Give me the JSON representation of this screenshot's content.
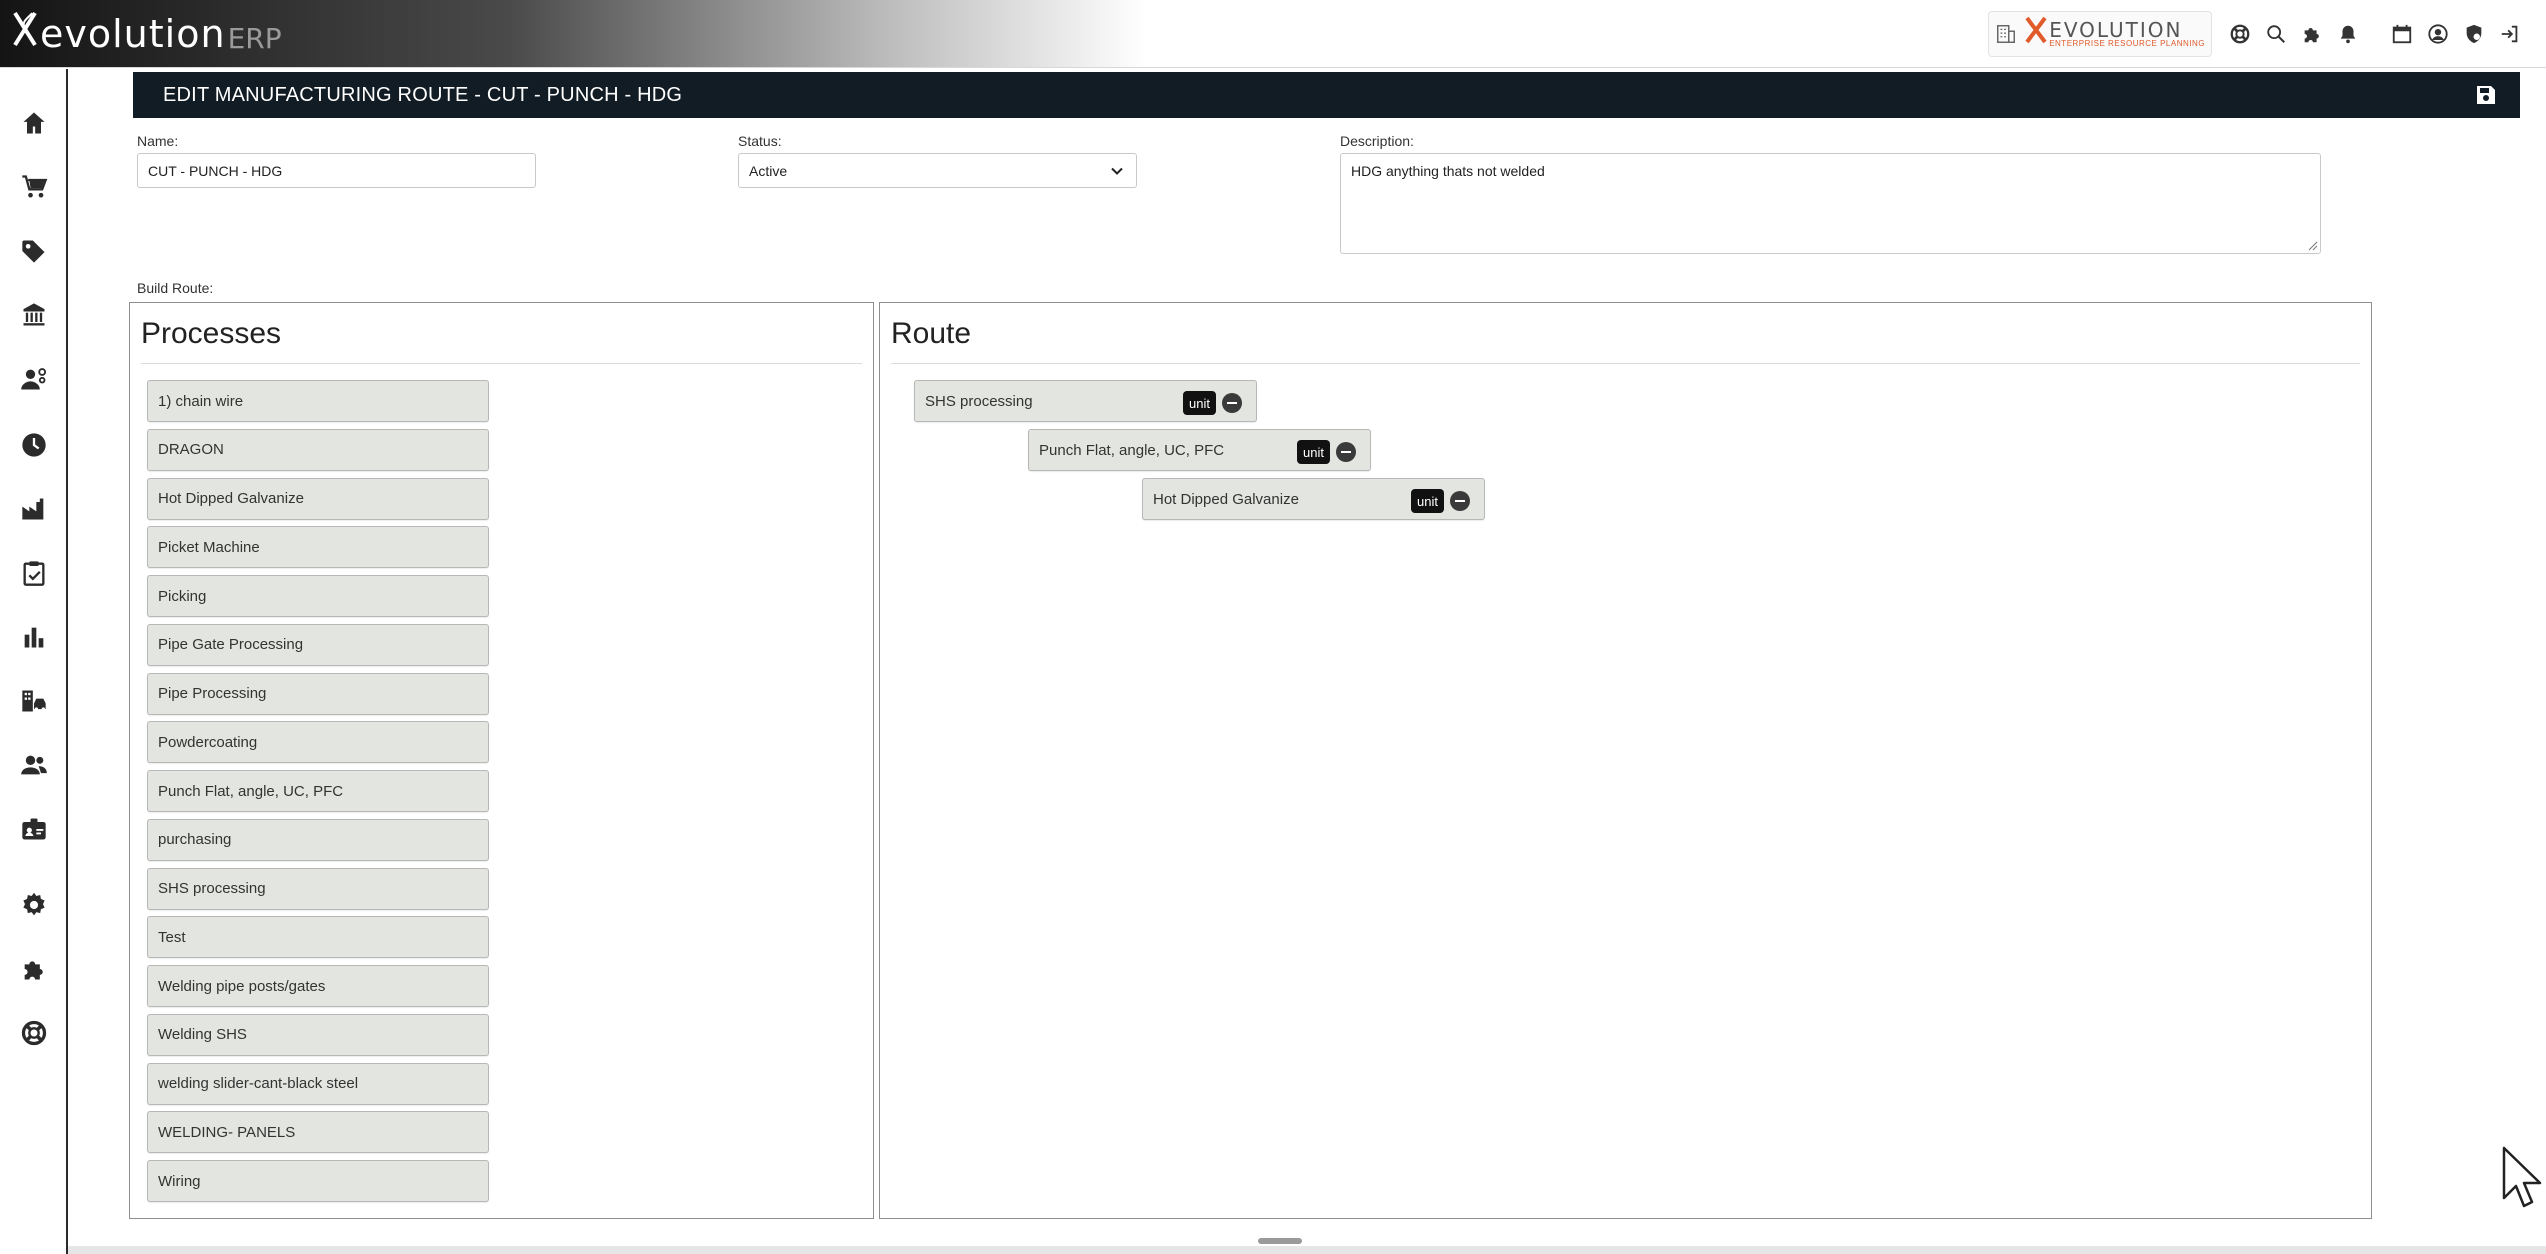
{
  "app": {
    "logo_word": "evolution",
    "logo_suffix": "ERP",
    "brand_name": "EVOLUTION",
    "brand_tagline": "ENTERPRISE RESOURCE PLANNING"
  },
  "topbar": {
    "icons": [
      "building-icon",
      "lifebuoy-icon",
      "search-icon",
      "puzzle-icon",
      "bell-icon",
      "calendar-icon",
      "user-circle-icon",
      "shield-icon",
      "logout-icon"
    ]
  },
  "sidebar": {
    "items": [
      {
        "name": "home-icon"
      },
      {
        "name": "cart-icon"
      },
      {
        "name": "tag-icon"
      },
      {
        "name": "bank-icon"
      },
      {
        "name": "worker-icon"
      },
      {
        "name": "clock-icon"
      },
      {
        "name": "factory-icon"
      },
      {
        "name": "clipboard-check-icon"
      },
      {
        "name": "bar-chart-icon"
      },
      {
        "name": "buildings-car-icon"
      },
      {
        "name": "users-icon"
      },
      {
        "name": "id-badge-icon"
      },
      {
        "name": "gear-icon"
      },
      {
        "name": "puzzle-icon"
      },
      {
        "name": "lifebuoy-icon"
      }
    ]
  },
  "page": {
    "title": "EDIT MANUFACTURING ROUTE - CUT - PUNCH - HDG"
  },
  "form": {
    "name_label": "Name:",
    "name_value": "CUT - PUNCH - HDG",
    "status_label": "Status:",
    "status_value": "Active",
    "description_label": "Description:",
    "description_value": "HDG anything thats not welded",
    "build_route_label": "Build Route:"
  },
  "processes": {
    "title": "Processes",
    "items": [
      "1) chain wire",
      "DRAGON",
      "Hot Dipped Galvanize",
      "Picket Machine",
      "Picking",
      "Pipe Gate Processing",
      "Pipe Processing",
      "Powdercoating",
      "Punch Flat, angle, UC, PFC",
      "purchasing",
      "SHS processing",
      "Test",
      "Welding pipe posts/gates",
      "Welding SHS",
      "welding slider-cant-black steel",
      "WELDING- PANELS",
      "Wiring"
    ]
  },
  "route": {
    "title": "Route",
    "items": [
      {
        "label": "SHS processing",
        "badge": "unit"
      },
      {
        "label": "Punch Flat, angle, UC, PFC",
        "badge": "unit"
      },
      {
        "label": "Hot Dipped Galvanize",
        "badge": "unit"
      }
    ]
  },
  "colors": {
    "header_bg": "#121c24",
    "item_bg": "#e3e6e0",
    "brand_accent": "#e05a2a"
  }
}
